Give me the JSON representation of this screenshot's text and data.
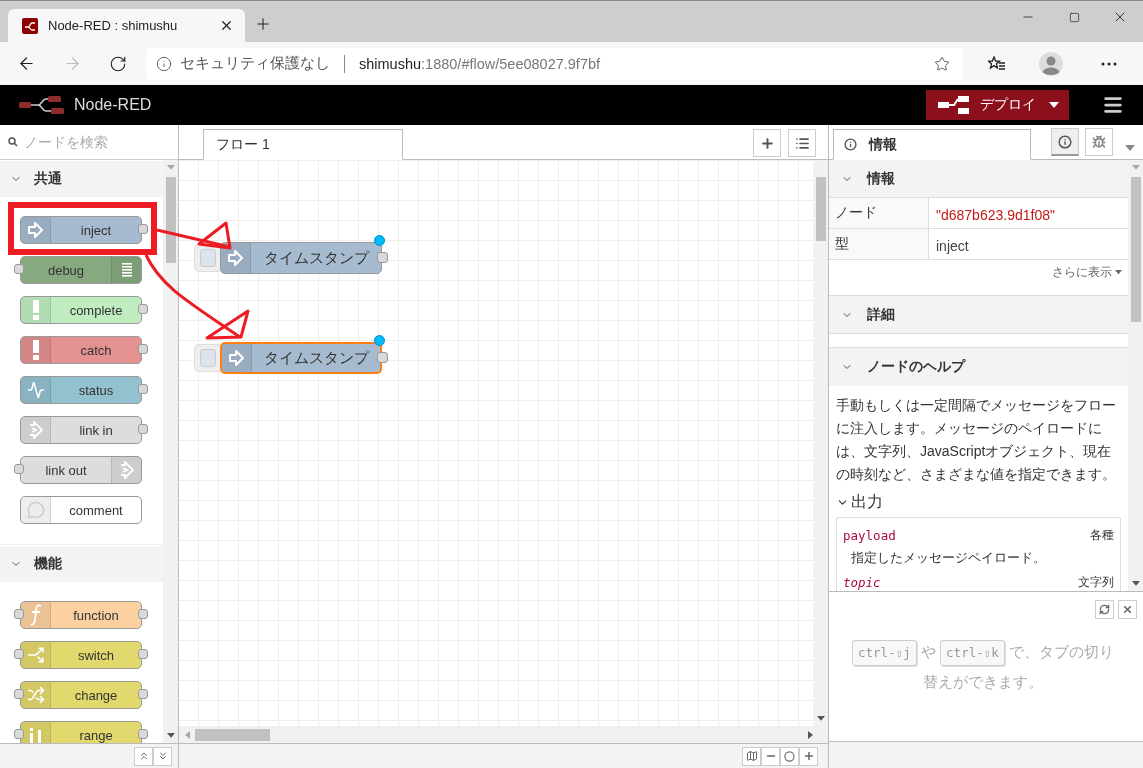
{
  "browser": {
    "tab_title": "Node-RED : shimushu",
    "security_label": "セキュリティ保護なし",
    "url_host": "shimushu",
    "url_path": ":1880/#flow/5ee08027.9f7bf"
  },
  "header": {
    "title": "Node-RED",
    "deploy_label": "デプロイ"
  },
  "palette": {
    "search_placeholder": "ノードを検索",
    "categories": [
      {
        "name": "共通",
        "expanded": true,
        "nodes": [
          {
            "label": "inject",
            "kind": "inject",
            "color": "#a6bbcf"
          },
          {
            "label": "debug",
            "kind": "debug",
            "color": "#87a980"
          },
          {
            "label": "complete",
            "kind": "complete",
            "color": "#c0edc0"
          },
          {
            "label": "catch",
            "kind": "catch",
            "color": "#e49191"
          },
          {
            "label": "status",
            "kind": "status",
            "color": "#94c1d0"
          },
          {
            "label": "link in",
            "kind": "link-in",
            "color": "#dddddd"
          },
          {
            "label": "link out",
            "kind": "link-out",
            "color": "#dddddd"
          },
          {
            "label": "comment",
            "kind": "comment",
            "color": "#ffffff"
          }
        ]
      },
      {
        "name": "機能",
        "expanded": true,
        "nodes": [
          {
            "label": "function",
            "kind": "function",
            "color": "#fdd0a2"
          },
          {
            "label": "switch",
            "kind": "switch",
            "color": "#e2d96e"
          },
          {
            "label": "change",
            "kind": "change",
            "color": "#e2d96e"
          },
          {
            "label": "range",
            "kind": "range",
            "color": "#e2d96e"
          }
        ]
      }
    ]
  },
  "workspace": {
    "tabs": [
      {
        "label": "フロー 1",
        "selected": true
      }
    ],
    "nodes": [
      {
        "label": "タイムスタンプ",
        "selected": false,
        "changed": true
      },
      {
        "label": "タイムスタンプ",
        "selected": true,
        "changed": true
      }
    ]
  },
  "sidebar": {
    "tabs": [
      {
        "label": "情報",
        "selected": true
      }
    ],
    "tab_buttons": [
      {
        "kind": "info",
        "selected": true
      },
      {
        "kind": "debug",
        "selected": false
      }
    ],
    "info": {
      "title": "情報",
      "expanded": true,
      "rows": [
        {
          "label": "ノード",
          "value": "\"d687b623.9d1f08\"",
          "kind": "string"
        },
        {
          "label": "型",
          "value": "inject",
          "kind": "plain"
        }
      ],
      "more": "さらに表示"
    },
    "details": {
      "title": "詳細",
      "expanded": true
    },
    "help": {
      "title": "ノードのヘルプ",
      "expanded": true,
      "text": "手動もしくは一定間隔でメッセージをフローに注入します。メッセージのペイロードには、文字列、JavaScriptオブジェクト、現在の時刻など、さまざまな値を指定できます。",
      "output": {
        "title": "出力",
        "expanded": true,
        "properties": [
          {
            "name": "payload",
            "type": "各種",
            "optional": false,
            "description": "指定したメッセージペイロード。"
          },
          {
            "name": "topic",
            "type": "文字列",
            "optional": true
          }
        ]
      }
    },
    "tips": {
      "keys": [
        "ctrl-⇧j",
        "ctrl-⇧k"
      ],
      "joiner": "や",
      "text": "で、タブの切り替えができます。"
    }
  }
}
